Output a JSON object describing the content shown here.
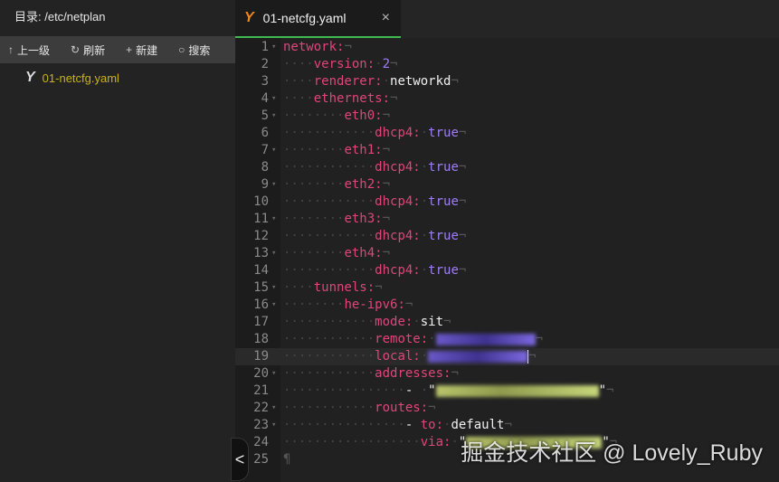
{
  "sidebar": {
    "directory_label": "目录: /etc/netplan",
    "toolbar": [
      {
        "icon": "arrow-up-icon",
        "glyph": "↑",
        "label": "上一级"
      },
      {
        "icon": "refresh-icon",
        "glyph": "↻",
        "label": "刷新"
      },
      {
        "icon": "plus-icon",
        "glyph": "+",
        "label": "新建"
      },
      {
        "icon": "search-icon",
        "glyph": "○",
        "label": "搜索"
      }
    ],
    "files": [
      {
        "name": "01-netcfg.yaml",
        "icon": "yaml-icon",
        "glyph": "Y"
      }
    ]
  },
  "tab": {
    "title": "01-netcfg.yaml",
    "glyph": "Y",
    "close": "×"
  },
  "collapse_glyph": "<",
  "watermark": "掘金技术社区 @ Lovely_Ruby",
  "colors": {
    "key": "#e0457b",
    "number": "#9f7ef5",
    "tab_underline": "#3fb950",
    "file": "#c9b21a"
  },
  "lines": [
    {
      "n": "1",
      "indent": 0,
      "key": "network:",
      "fold": true
    },
    {
      "n": "2",
      "indent": 4,
      "key": "version:",
      "val": "2",
      "t": "n"
    },
    {
      "n": "3",
      "indent": 4,
      "key": "renderer:",
      "val": "networkd",
      "t": "s"
    },
    {
      "n": "4",
      "indent": 4,
      "key": "ethernets:",
      "fold": true
    },
    {
      "n": "5",
      "indent": 8,
      "key": "eth0:",
      "fold": true
    },
    {
      "n": "6",
      "indent": 12,
      "key": "dhcp4:",
      "val": "true",
      "t": "n"
    },
    {
      "n": "7",
      "indent": 8,
      "key": "eth1:",
      "fold": true
    },
    {
      "n": "8",
      "indent": 12,
      "key": "dhcp4:",
      "val": "true",
      "t": "n"
    },
    {
      "n": "9",
      "indent": 8,
      "key": "eth2:",
      "fold": true
    },
    {
      "n": "10",
      "indent": 12,
      "key": "dhcp4:",
      "val": "true",
      "t": "n"
    },
    {
      "n": "11",
      "indent": 8,
      "key": "eth3:",
      "fold": true
    },
    {
      "n": "12",
      "indent": 12,
      "key": "dhcp4:",
      "val": "true",
      "t": "n"
    },
    {
      "n": "13",
      "indent": 8,
      "key": "eth4:",
      "fold": true
    },
    {
      "n": "14",
      "indent": 12,
      "key": "dhcp4:",
      "val": "true",
      "t": "n"
    },
    {
      "n": "15",
      "indent": 4,
      "key": "tunnels:",
      "fold": true
    },
    {
      "n": "16",
      "indent": 8,
      "key": "he-ipv6:",
      "fold": true
    },
    {
      "n": "17",
      "indent": 12,
      "key": "mode:",
      "val": "sit",
      "t": "s"
    },
    {
      "n": "18",
      "indent": 12,
      "key": "remote:",
      "blur": "n",
      "bw": 110
    },
    {
      "n": "19",
      "indent": 12,
      "key": "local:",
      "blur": "n",
      "bw": 110,
      "active": true
    },
    {
      "n": "20",
      "indent": 12,
      "key": "addresses:",
      "fold": true
    },
    {
      "n": "21",
      "indent": 16,
      "dash": true,
      "blur": "q",
      "bw": 180
    },
    {
      "n": "22",
      "indent": 12,
      "key": "routes:",
      "fold": true
    },
    {
      "n": "23",
      "indent": 16,
      "dash": true,
      "key": "to:",
      "val": "default",
      "t": "s",
      "fold": true
    },
    {
      "n": "24",
      "indent": 18,
      "key": "via:",
      "blur": "q",
      "bw": 150
    },
    {
      "n": "25",
      "indent": 0,
      "pilcrow": "¶"
    }
  ]
}
